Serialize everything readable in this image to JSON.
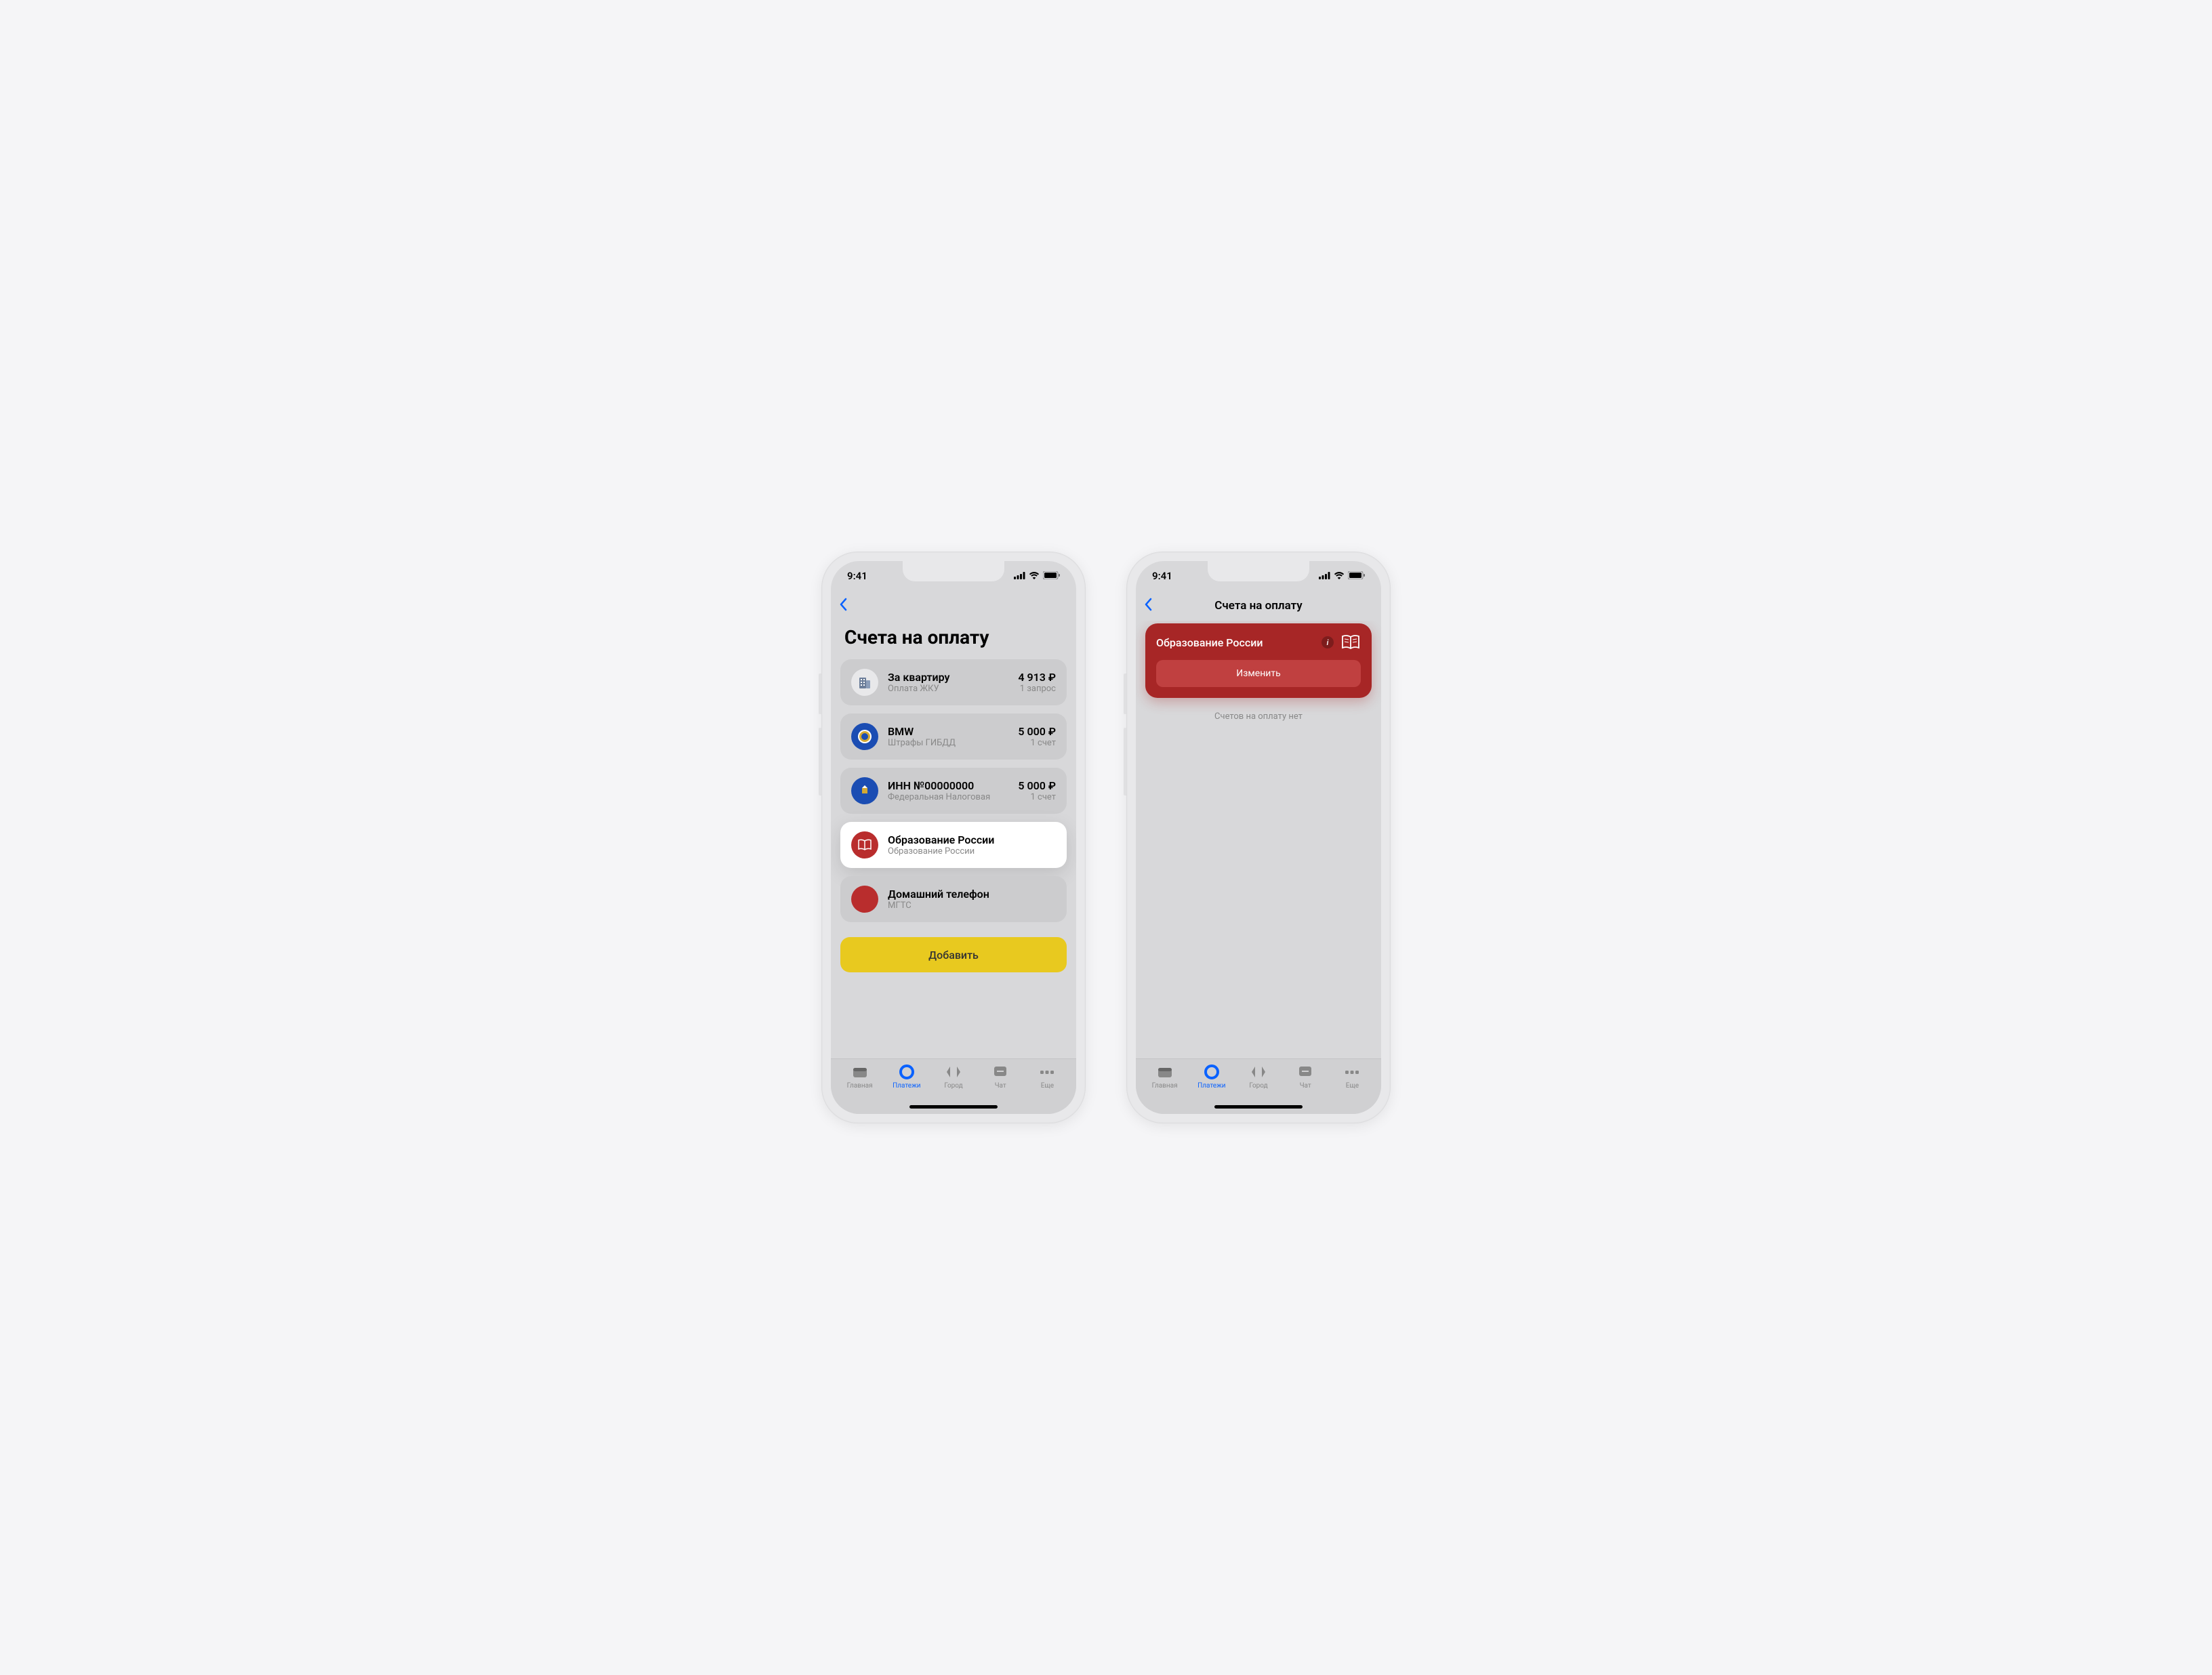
{
  "status": {
    "time": "9:41"
  },
  "screen1": {
    "page_title": "Счета на оплату",
    "items": [
      {
        "title": "За квартиру",
        "sub": "Оплата ЖКУ",
        "amount": "4 913 ₽",
        "count": "1 запрос"
      },
      {
        "title": "BMW",
        "sub": "Штрафы ГИБДД",
        "amount": "5 000 ₽",
        "count": "1 счет"
      },
      {
        "title": "ИНН №00000000",
        "sub": "Федеральная Налоговая",
        "amount": "5 000 ₽",
        "count": "1 счет"
      },
      {
        "title": "Образование России",
        "sub": "Образование России"
      },
      {
        "title": "Домашний телефон",
        "sub": "МГТС"
      }
    ],
    "add_label": "Добавить"
  },
  "screen2": {
    "nav_title": "Счета на оплату",
    "panel_title": "Образование России",
    "change_label": "Изменить",
    "empty": "Счетов на оплату нет"
  },
  "tabs": {
    "home": "Главная",
    "payments": "Платежи",
    "city": "Город",
    "chat": "Чат",
    "more": "Еще"
  }
}
